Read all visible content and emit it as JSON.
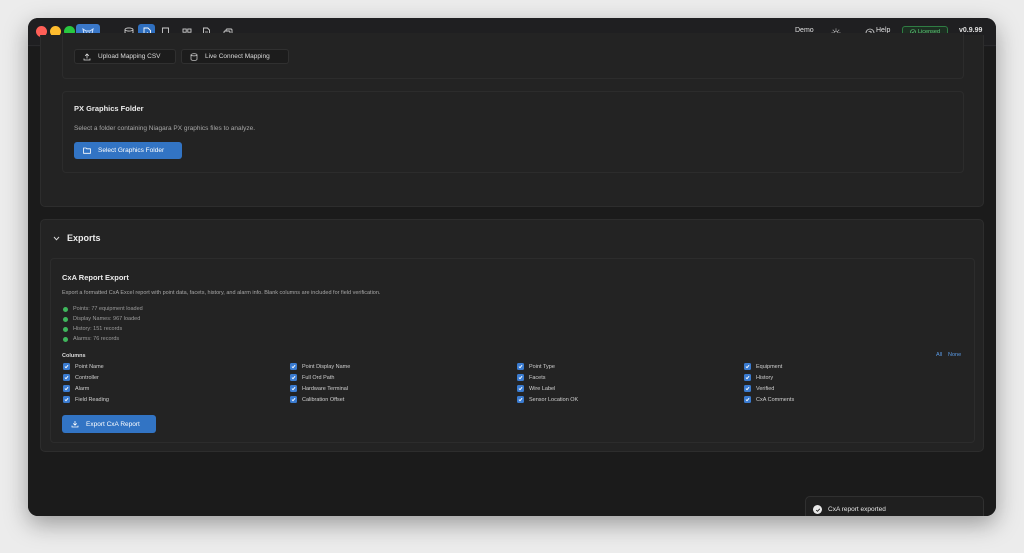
{
  "header": {
    "workspace": "Demo",
    "help_label": "Help",
    "license_label": "Licensed",
    "version": "v0.9.99",
    "nav_icons": [
      "database-icon",
      "file-import-icon",
      "bookmark-icon",
      "dashboard-icon",
      "document-icon",
      "copy-icon"
    ]
  },
  "import_section": {
    "upload_button": "Upload Mapping CSV",
    "live_button": "Live Connect Mapping"
  },
  "px_graphics": {
    "title": "PX Graphics Folder",
    "description": "Select a folder containing Niagara PX graphics files to analyze.",
    "button": "Select Graphics Folder"
  },
  "exports": {
    "section_title": "Exports",
    "report": {
      "title": "CxA Report Export",
      "description": "Export a formatted CxA Excel report with point data, facets, history, and alarm info. Blank columns are included for field verification.",
      "stats": [
        "Points: 77 equipment loaded",
        "Display Names: 967 loaded",
        "History: 151 records",
        "Alarms: 76 records"
      ],
      "columns_label": "Columns",
      "all_label": "All",
      "none_label": "None",
      "columns": [
        "Point Name",
        "Point Display Name",
        "Point Type",
        "Equipment",
        "Controller",
        "Full Ord Path",
        "Facets",
        "History",
        "Alarm",
        "Hardware Terminal",
        "Wire Label",
        "Verified",
        "Field Reading",
        "Calibration Offset",
        "Sensor Location OK",
        "CxA Comments"
      ],
      "export_button": "Export CxA Report"
    }
  },
  "toast": {
    "message": "CxA report exported"
  },
  "colors": {
    "accent": "#3274c4",
    "success": "#3fb65c",
    "background": "#1b1b1b",
    "card": "#232323"
  }
}
